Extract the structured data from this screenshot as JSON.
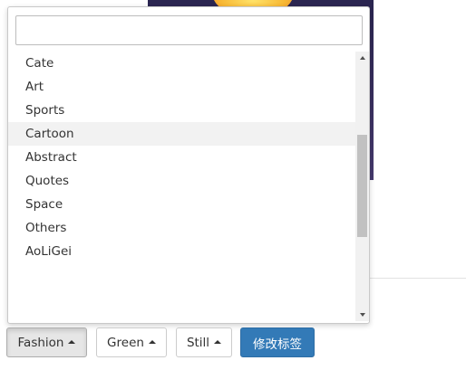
{
  "dropdown": {
    "search": {
      "value": "",
      "placeholder": ""
    },
    "items": [
      {
        "label": "Cate"
      },
      {
        "label": "Art"
      },
      {
        "label": "Sports"
      },
      {
        "label": "Cartoon",
        "hovered": true
      },
      {
        "label": "Abstract"
      },
      {
        "label": "Quotes"
      },
      {
        "label": "Space"
      },
      {
        "label": "Others"
      },
      {
        "label": "AoLiGei"
      }
    ],
    "scrollbar": {
      "up_icon": "scroll-up-arrow",
      "down_icon": "scroll-down-arrow"
    }
  },
  "toolbar": {
    "fashion_label": "Fashion",
    "green_label": "Green",
    "still_label": "Still",
    "modify_label": "修改标签",
    "caret_icon": "caret-up-icon",
    "primary_color": "#337ab7"
  }
}
